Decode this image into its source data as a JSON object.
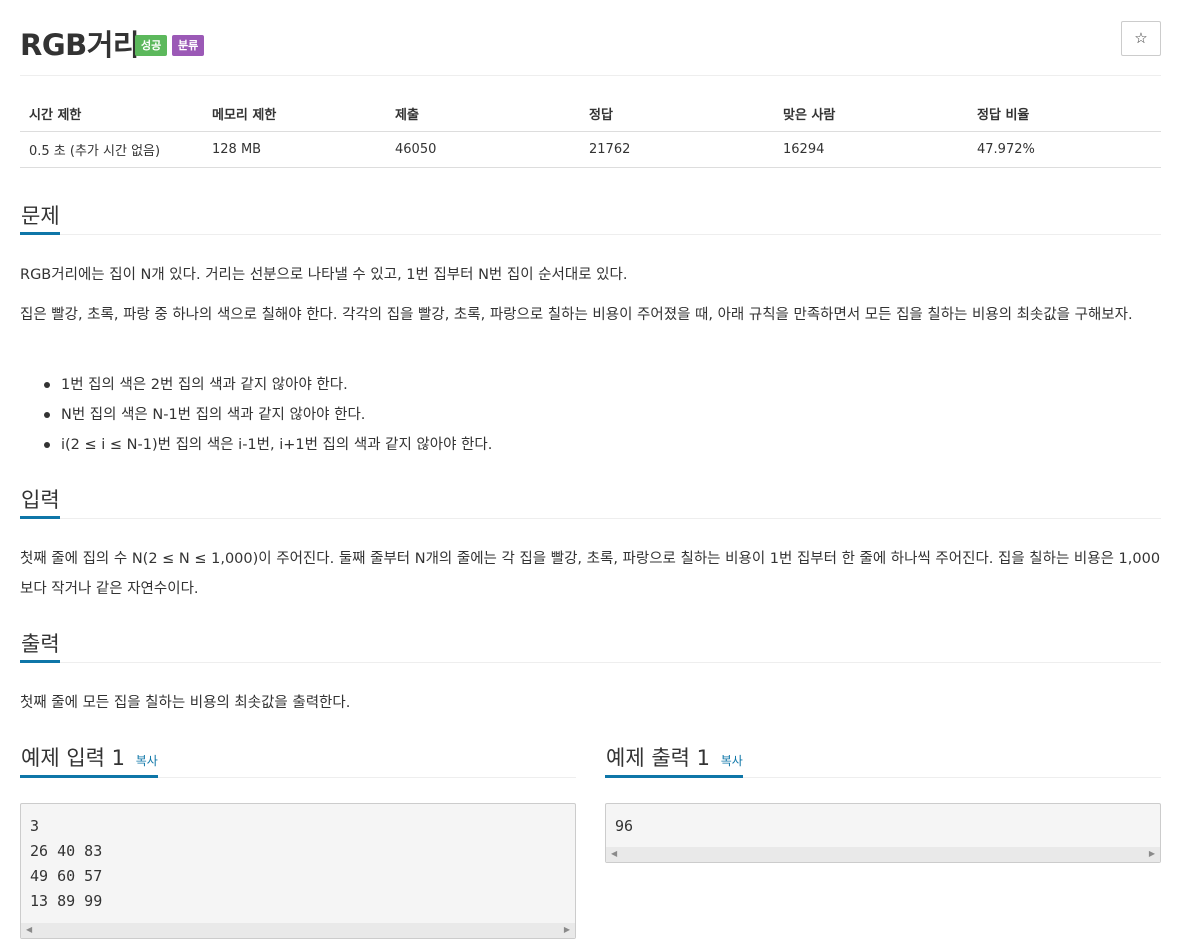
{
  "problem": {
    "title": "RGB거리",
    "badges": {
      "success": "성공",
      "category": "분류"
    },
    "star_icon": "☆"
  },
  "info_table": {
    "headers": [
      "시간 제한",
      "메모리 제한",
      "제출",
      "정답",
      "맞은 사람",
      "정답 비율"
    ],
    "values": [
      "0.5 초 (추가 시간 없음)",
      "128 MB",
      "46050",
      "21762",
      "16294",
      "47.972%"
    ]
  },
  "sections": {
    "description": {
      "heading": "문제",
      "paragraph1": "RGB거리에는 집이 N개 있다. 거리는 선분으로 나타낼 수 있고, 1번 집부터 N번 집이 순서대로 있다.",
      "paragraph2": "집은 빨강, 초록, 파랑 중 하나의 색으로 칠해야 한다. 각각의 집을 빨강, 초록, 파랑으로 칠하는 비용이 주어졌을 때, 아래 규칙을 만족하면서 모든 집을 칠하는 비용의 최솟값을 구해보자.",
      "rules": [
        "1번 집의 색은 2번 집의 색과 같지 않아야 한다.",
        "N번 집의 색은 N-1번 집의 색과 같지 않아야 한다.",
        "i(2 ≤ i ≤ N-1)번 집의 색은 i-1번, i+1번 집의 색과 같지 않아야 한다."
      ]
    },
    "input": {
      "heading": "입력",
      "text": "첫째 줄에 집의 수 N(2 ≤ N ≤ 1,000)이 주어진다. 둘째 줄부터 N개의 줄에는 각 집을 빨강, 초록, 파랑으로 칠하는 비용이 1번 집부터 한 줄에 하나씩 주어진다. 집을 칠하는 비용은 1,000보다 작거나 같은 자연수이다."
    },
    "output": {
      "heading": "출력",
      "text": "첫째 줄에 모든 집을 칠하는 비용의 최솟값을 출력한다."
    }
  },
  "samples": {
    "input": {
      "label": "예제 입력 1",
      "copy": "복사",
      "content": "3\n26 40 83\n49 60 57\n13 89 99"
    },
    "output": {
      "label": "예제 출력 1",
      "copy": "복사",
      "content": "96"
    }
  },
  "colors": {
    "success": "#5cb85c",
    "category": "#9b59b6",
    "accent": "#0e76a8"
  }
}
